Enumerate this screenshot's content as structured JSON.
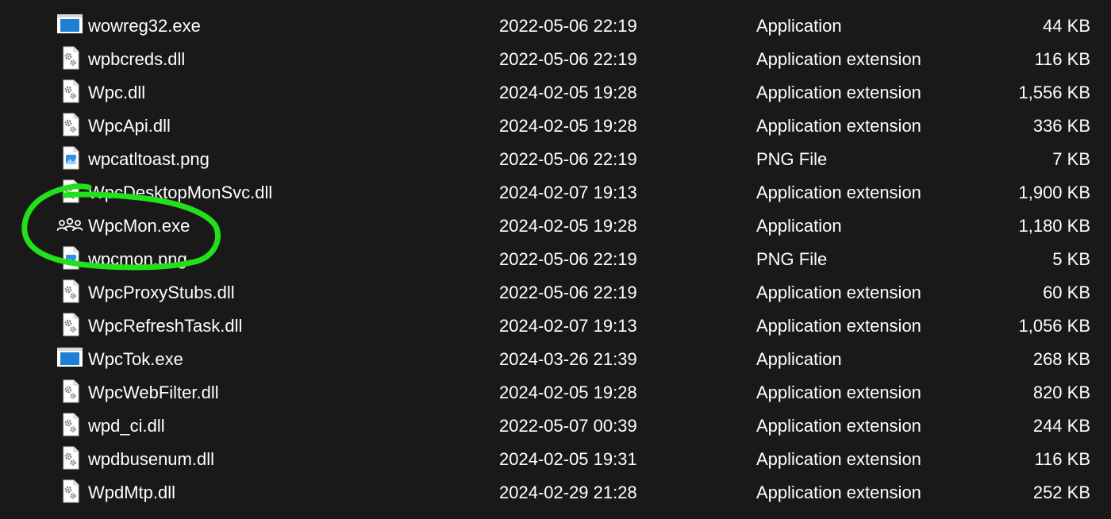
{
  "annotation_color": "#22e01a",
  "files": [
    {
      "name": "wowreg32.exe",
      "date": "2022-05-06 22:19",
      "type": "Application",
      "size": "44 KB",
      "icon": "application-window-icon"
    },
    {
      "name": "wpbcreds.dll",
      "date": "2022-05-06 22:19",
      "type": "Application extension",
      "size": "116 KB",
      "icon": "dll-gear-file-icon"
    },
    {
      "name": "Wpc.dll",
      "date": "2024-02-05 19:28",
      "type": "Application extension",
      "size": "1,556 KB",
      "icon": "dll-gear-file-icon"
    },
    {
      "name": "WpcApi.dll",
      "date": "2024-02-05 19:28",
      "type": "Application extension",
      "size": "336 KB",
      "icon": "dll-gear-file-icon"
    },
    {
      "name": "wpcatltoast.png",
      "date": "2022-05-06 22:19",
      "type": "PNG File",
      "size": "7 KB",
      "icon": "png-image-file-icon"
    },
    {
      "name": "WpcDesktopMonSvc.dll",
      "date": "2024-02-07 19:13",
      "type": "Application extension",
      "size": "1,900 KB",
      "icon": "dll-gear-file-icon"
    },
    {
      "name": "WpcMon.exe",
      "date": "2024-02-05 19:28",
      "type": "Application",
      "size": "1,180 KB",
      "icon": "family-people-icon"
    },
    {
      "name": "wpcmon.png",
      "date": "2022-05-06 22:19",
      "type": "PNG File",
      "size": "5 KB",
      "icon": "png-image-file-icon"
    },
    {
      "name": "WpcProxyStubs.dll",
      "date": "2022-05-06 22:19",
      "type": "Application extension",
      "size": "60 KB",
      "icon": "dll-gear-file-icon"
    },
    {
      "name": "WpcRefreshTask.dll",
      "date": "2024-02-07 19:13",
      "type": "Application extension",
      "size": "1,056 KB",
      "icon": "dll-gear-file-icon"
    },
    {
      "name": "WpcTok.exe",
      "date": "2024-03-26 21:39",
      "type": "Application",
      "size": "268 KB",
      "icon": "application-window-icon"
    },
    {
      "name": "WpcWebFilter.dll",
      "date": "2024-02-05 19:28",
      "type": "Application extension",
      "size": "820 KB",
      "icon": "dll-gear-file-icon"
    },
    {
      "name": "wpd_ci.dll",
      "date": "2022-05-07 00:39",
      "type": "Application extension",
      "size": "244 KB",
      "icon": "dll-gear-file-icon"
    },
    {
      "name": "wpdbusenum.dll",
      "date": "2024-02-05 19:31",
      "type": "Application extension",
      "size": "116 KB",
      "icon": "dll-gear-file-icon"
    },
    {
      "name": "WpdMtp.dll",
      "date": "2024-02-29 21:28",
      "type": "Application extension",
      "size": "252 KB",
      "icon": "dll-gear-file-icon"
    }
  ]
}
